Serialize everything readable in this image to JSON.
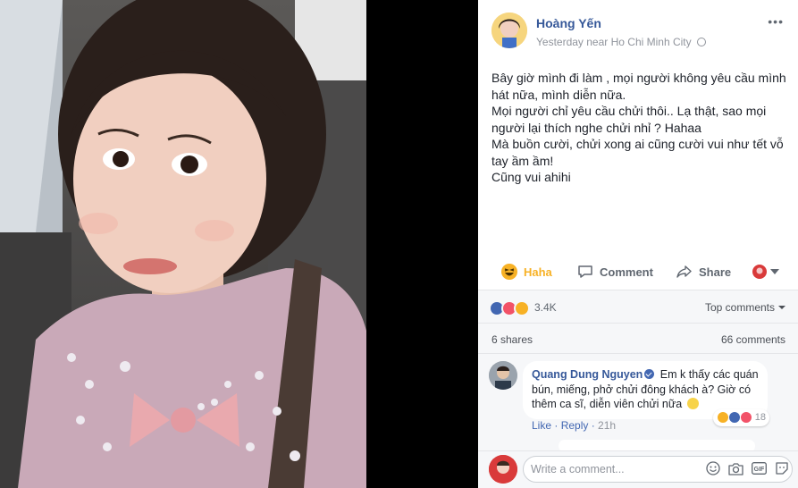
{
  "post": {
    "author": "Hoàng Yến",
    "meta": "Yesterday near Ho Chi Minh City",
    "more_label": "•••",
    "text_lines": [
      "Bây giờ mình đi làm , mọi người không yêu cầu mình hát nữa, mình diễn nữa.",
      "Mọi người chỉ yêu cầu chửi thôi.. Lạ thật, sao mọi người lại thích nghe chửi nhỉ ? Hahaa",
      "Mà buồn cười, chửi xong ai cũng cười vui như tết vỗ tay ầm ầm!",
      "Cũng vui ahihi"
    ]
  },
  "actions": {
    "haha": "Haha",
    "comment": "Comment",
    "share": "Share"
  },
  "stats": {
    "reactions_count": "3.4K",
    "top_comments": "Top comments",
    "shares": "6 shares",
    "comments": "66 comments"
  },
  "comment": {
    "author": "Quang Dung Nguyen",
    "text": "Em k thấy các quán bún, miếng, phở chửi đông khách à? Giờ có thêm ca sĩ, diễn viên chửi nữa",
    "reaction_count": "18",
    "like": "Like",
    "reply": "Reply",
    "time": "21h"
  },
  "composer": {
    "placeholder": "Write a comment..."
  },
  "colors": {
    "link_blue": "#365899",
    "haha_yellow": "#f7b125",
    "like_blue": "#4267b2",
    "love_red": "#f25268"
  }
}
